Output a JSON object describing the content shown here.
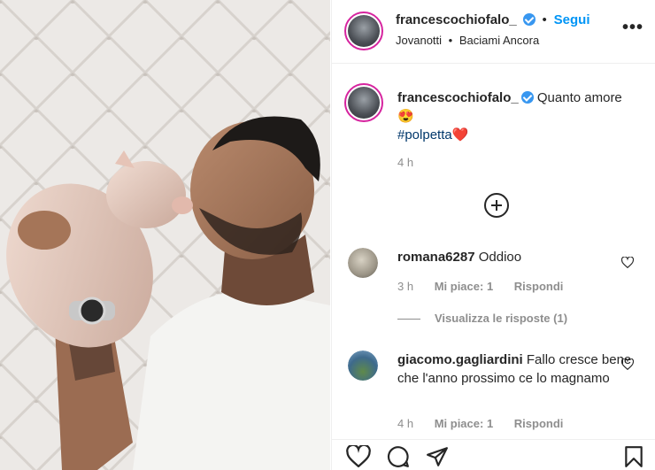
{
  "post": {
    "author": "francescochiofalo_",
    "follow_label": "Segui",
    "separator": "•",
    "music_artist": "Jovanotti",
    "music_separator": "•",
    "music_track": "Baciami Ancora",
    "more_label": "•••",
    "caption_text": "Quanto amore",
    "caption_emoji": "😍",
    "caption_hashtag": "#polpetta",
    "caption_heart": "❤️",
    "caption_time": "4 h"
  },
  "comments": [
    {
      "user": "romana6287",
      "text": "Oddioo",
      "time": "3 h",
      "likes": "Mi piace: 1",
      "reply": "Rispondi",
      "view_replies": "Visualizza le risposte (1)"
    },
    {
      "user": "giacomo.gagliardini",
      "text": "Fallo cresce bene che l'anno prossimo ce lo magnamo",
      "time": "4 h",
      "likes": "Mi piace: 1",
      "reply": "Rispondi"
    }
  ],
  "icons": {
    "like": "heart-icon",
    "comment": "comment-icon",
    "share": "share-icon",
    "save": "bookmark-icon",
    "add": "plus-circle-icon",
    "verified": "verified-badge-icon"
  },
  "colors": {
    "accent": "#0095f6",
    "verified": "#3897f0",
    "hashtag": "#00376b",
    "muted": "#8e8e8e"
  }
}
